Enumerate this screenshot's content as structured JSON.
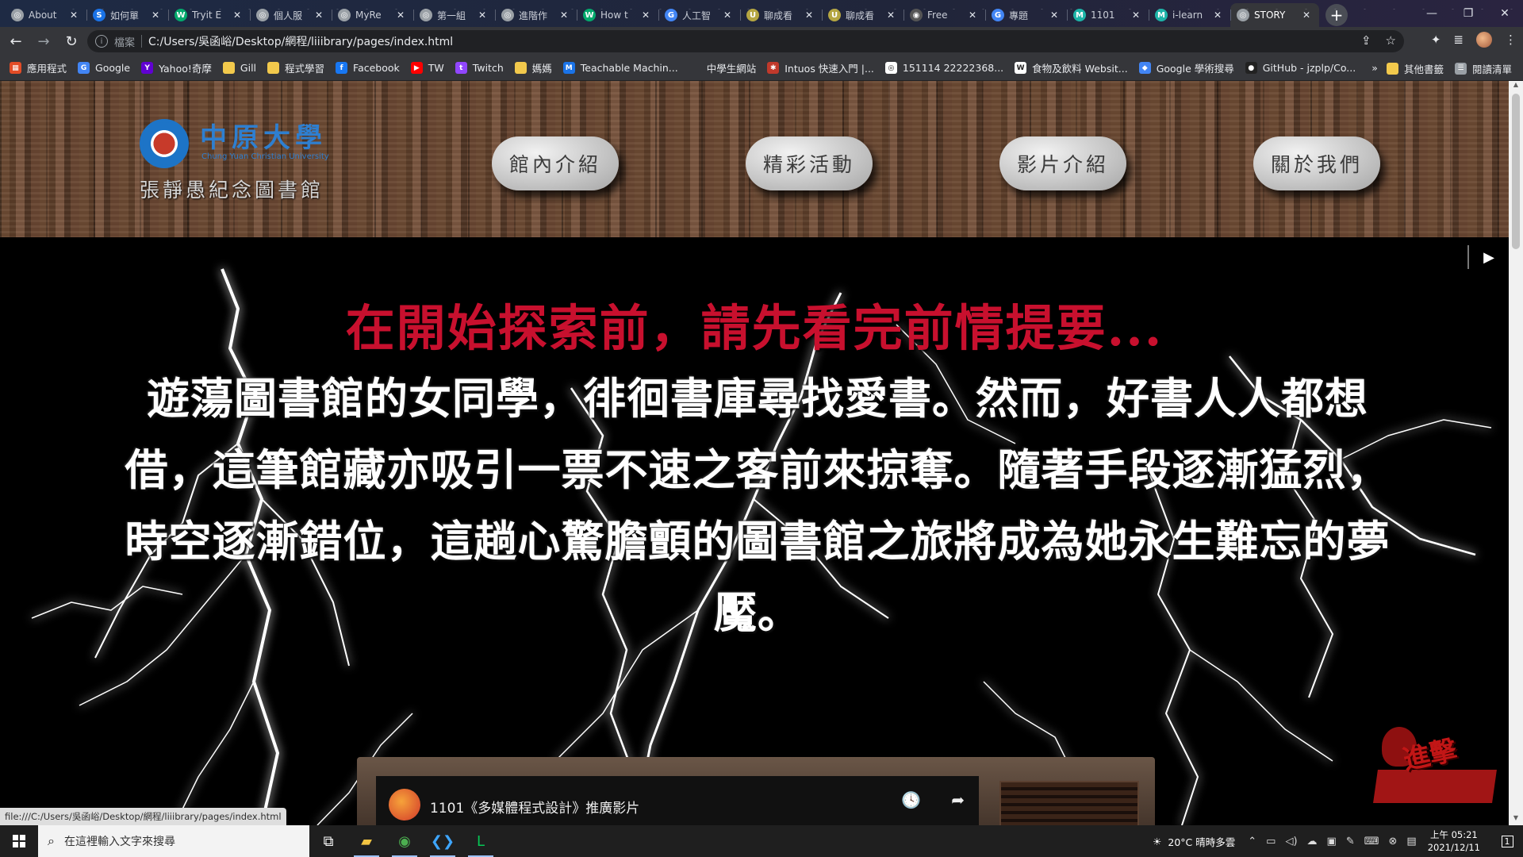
{
  "browser": {
    "tabs": [
      {
        "title": "About",
        "fav_color": "#9aa0a6",
        "fav": "◎"
      },
      {
        "title": "如何單",
        "fav_color": "#1a73e8",
        "fav": "S"
      },
      {
        "title": "Tryit E",
        "fav_color": "#04aa6d",
        "fav": "W"
      },
      {
        "title": "個人服",
        "fav_color": "#9aa0a6",
        "fav": "◎"
      },
      {
        "title": "MyRe",
        "fav_color": "#9aa0a6",
        "fav": "◎"
      },
      {
        "title": "第一組",
        "fav_color": "#9aa0a6",
        "fav": "◎"
      },
      {
        "title": "進階作",
        "fav_color": "#9aa0a6",
        "fav": "◎"
      },
      {
        "title": "How t",
        "fav_color": "#04aa6d",
        "fav": "W"
      },
      {
        "title": "人工智",
        "fav_color": "#4285f4",
        "fav": "G"
      },
      {
        "title": "聊成看",
        "fav_color": "#b5a642",
        "fav": "U"
      },
      {
        "title": "聊成看",
        "fav_color": "#b5a642",
        "fav": "U"
      },
      {
        "title": "Free",
        "fav_color": "#555555",
        "fav": "◉"
      },
      {
        "title": "專題",
        "fav_color": "#4285f4",
        "fav": "G"
      },
      {
        "title": "1101",
        "fav_color": "#1db4a8",
        "fav": "M"
      },
      {
        "title": "i-learn",
        "fav_color": "#1db4a8",
        "fav": "M"
      },
      {
        "title": "STORY",
        "fav_color": "#9aa0a6",
        "fav": "◎"
      }
    ],
    "new_tab_glyph": "+",
    "window_controls": [
      "—",
      "❐",
      "✕"
    ],
    "address": {
      "scheme_label": "檔案",
      "url": "C:/Users/吳函峪/Desktop/網程/liiibrary/pages/index.html"
    },
    "bookmarks": [
      {
        "label": "應用程式",
        "icon_color": "#e34c26",
        "icon": "▦"
      },
      {
        "label": "Google",
        "icon_color": "#4285f4",
        "icon": "G"
      },
      {
        "label": "Yahoo!奇摩",
        "icon_color": "#6001d2",
        "icon": "Y"
      },
      {
        "label": "Gill",
        "icon_color": "#f2c94c",
        "icon": ""
      },
      {
        "label": "程式學習",
        "icon_color": "#f2c94c",
        "icon": ""
      },
      {
        "label": "Facebook",
        "icon_color": "#1877f2",
        "icon": "f"
      },
      {
        "label": "TW",
        "icon_color": "#ff0000",
        "icon": "▶"
      },
      {
        "label": "Twitch",
        "icon_color": "#9146ff",
        "icon": "t"
      },
      {
        "label": "媽媽",
        "icon_color": "#f2c94c",
        "icon": ""
      },
      {
        "label": "Teachable Machin...",
        "icon_color": "#1a73e8",
        "icon": "M"
      },
      {
        "label": "中學生網站",
        "icon_color": "#35363a",
        "icon": ""
      },
      {
        "label": "Intuos 快速入門 |...",
        "icon_color": "#c0392b",
        "icon": "✱"
      },
      {
        "label": "151114 22222368...",
        "icon_color": "#ffffff",
        "icon": "◎"
      },
      {
        "label": "食物及飲料 Websit...",
        "icon_color": "#ffffff",
        "icon": "W"
      },
      {
        "label": "Google 學術搜尋",
        "icon_color": "#4285f4",
        "icon": "◆"
      },
      {
        "label": "GitHub - jzplp/Co...",
        "icon_color": "#222222",
        "icon": "●"
      }
    ],
    "bookmarks_more": "»",
    "bookmarks_right": [
      {
        "label": "其他書籤",
        "icon_color": "#f2c94c",
        "icon": ""
      },
      {
        "label": "閱讀清單",
        "icon_color": "#9aa0a6",
        "icon": "☰"
      }
    ]
  },
  "site": {
    "logo": {
      "chinese_name": "中原大學",
      "english_name": "Chung Yuan Christian University",
      "library_name": "張靜愚紀念圖書館"
    },
    "nav": [
      {
        "label": "館內介紹"
      },
      {
        "label": "精彩活動"
      },
      {
        "label": "影片介紹"
      },
      {
        "label": "關於我們"
      }
    ],
    "play_button": "▶",
    "story": {
      "headline": "在開始探索前，請先看完前情提要...",
      "paragraph": "遊蕩圖書館的女同學，徘徊書庫尋找愛書。然而，好書人人都想借，這筆館藏亦吸引一票不速之客前來掠奪。隨著手段逐漸猛烈，時空逐漸錯位，這趟心驚膽顫的圖書館之旅將成為她永生難忘的夢魘。"
    },
    "video": {
      "title": "1101《多媒體程式設計》推廣影片",
      "icons": [
        "🕓",
        "➦"
      ]
    },
    "stamp_text": "進擊"
  },
  "status_bar": {
    "link": "file:///C:/Users/吳函峪/Desktop/網程/liiibrary/pages/index.html"
  },
  "taskbar": {
    "search_placeholder": "在這裡輸入文字來搜尋",
    "apps": [
      {
        "name": "task-view",
        "glyph": "⧉",
        "color": "#ffffff",
        "active": false
      },
      {
        "name": "file-explorer",
        "glyph": "▰",
        "color": "#f4c542",
        "active": true
      },
      {
        "name": "chrome",
        "glyph": "◉",
        "color": "#4caf50",
        "active": true
      },
      {
        "name": "vscode",
        "glyph": "❮❯",
        "color": "#3ea6ff",
        "active": true
      },
      {
        "name": "line",
        "glyph": "L",
        "color": "#06c755",
        "active": true
      }
    ],
    "weather": "20°C  晴時多雲",
    "time": "上午 05:21",
    "date": "2021/12/11",
    "notifications": "1"
  }
}
